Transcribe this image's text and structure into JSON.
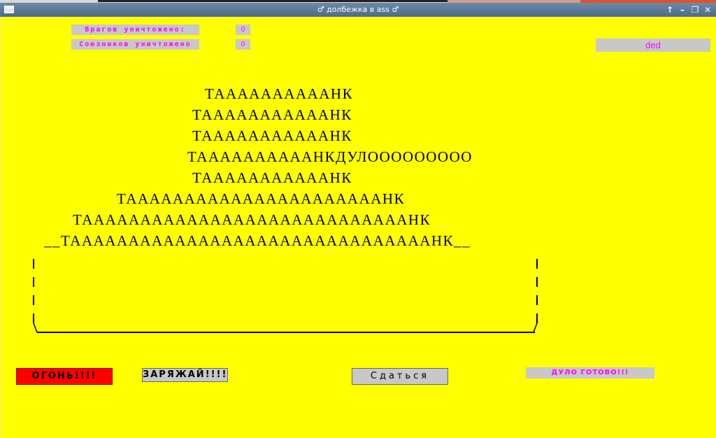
{
  "window": {
    "title": "♂ долбежка в ass ♂",
    "controls": [
      "↑",
      "–",
      "❐",
      "✕"
    ]
  },
  "stats": {
    "enemies_label": "Врагов уничтожено:",
    "enemies_value": "0",
    "allies_label": "Союзников уничтожено",
    "allies_value": "0"
  },
  "player": {
    "name": "ded"
  },
  "tank": {
    "rows": [
      "ТААААААААААНК",
      "ТАААААААААААНК",
      "ТАААААААААААНК",
      "ТААААААААААНКДУЛООООООООО",
      "ТАААААААААААНК",
      "ТААААААААААААААААААААААНК",
      "ТААААААААААААААААААААААААААААНК",
      "__ТАААААААААААААААААААААААААААААААНК__"
    ]
  },
  "buttons": {
    "fire": "ОГОНЬ!!!!",
    "load": "ЗАРЯЖАЙ!!!!",
    "surrender": "Сдаться"
  },
  "status": {
    "text": "ДУЛО ГОТОВО!!!"
  }
}
